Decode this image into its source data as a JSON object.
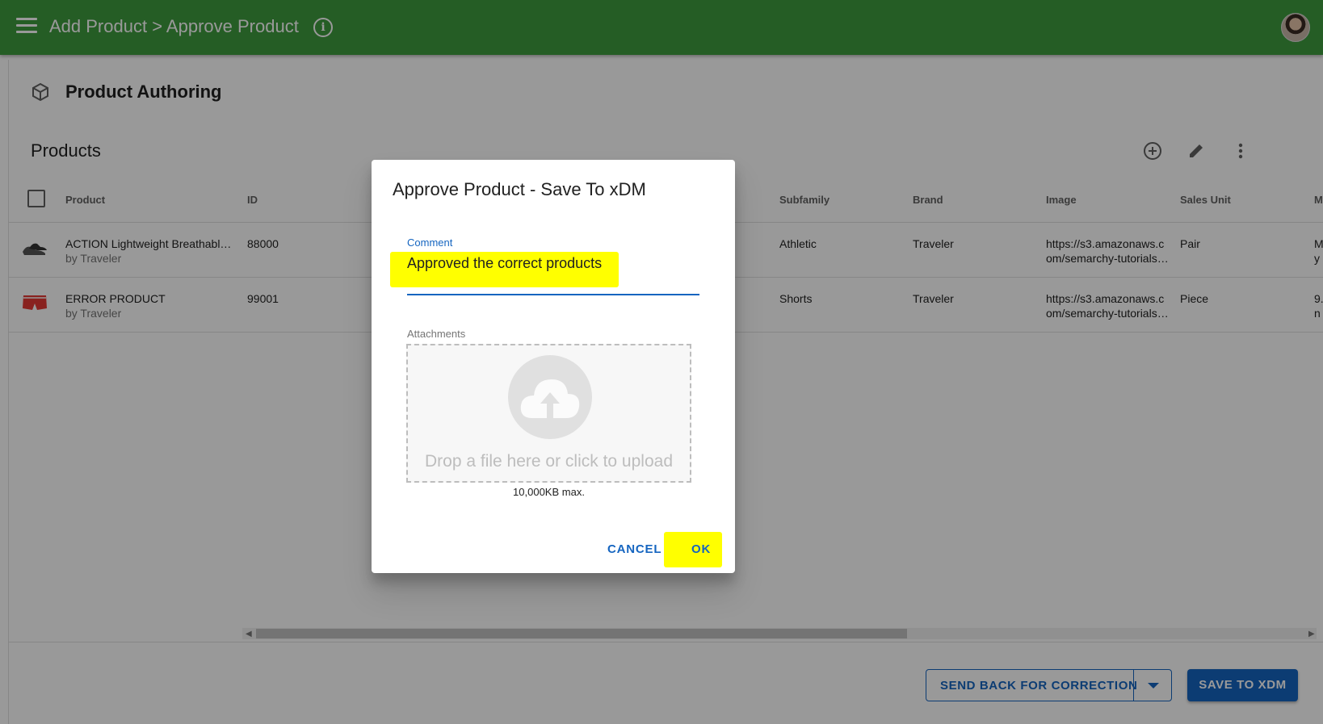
{
  "appbar": {
    "title": "Add Product > Approve Product",
    "info_icon_glyph": "i"
  },
  "page": {
    "section_title": "Product Authoring",
    "list_title": "Products"
  },
  "table": {
    "columns": [
      "Product",
      "ID",
      "Subfamily",
      "Brand",
      "Image",
      "Sales Unit",
      "M"
    ],
    "rows": [
      {
        "product": "ACTION Lightweight Breathabl…",
        "by": "by Traveler",
        "id": "88000",
        "subfamily": "Athletic",
        "brand": "Traveler",
        "image_line1": "https://s3.amazonaws.c",
        "image_line2": "om/semarchy-tutorials…",
        "sales_unit": "Pair",
        "extra_line1": "M",
        "extra_line2": "y"
      },
      {
        "product": "ERROR PRODUCT",
        "by": "by Traveler",
        "id": "99001",
        "subfamily": "Shorts",
        "brand": "Traveler",
        "image_line1": "https://s3.amazonaws.c",
        "image_line2": "om/semarchy-tutorials…",
        "sales_unit": "Piece",
        "extra_line1": "9.",
        "extra_line2": "n"
      }
    ]
  },
  "actions": {
    "send_back": "SEND BACK FOR CORRECTION",
    "save": "SAVE TO XDM"
  },
  "dialog": {
    "title": "Approve Product - Save To xDM",
    "comment_label": "Comment",
    "comment_value": "Approved the correct products",
    "attachments_label": "Attachments",
    "drop_text": "Drop a file here or click to upload",
    "max_size": "10,000KB max.",
    "cancel": "CANCEL",
    "ok": "OK"
  },
  "colors": {
    "appbar": "#3f9b3f",
    "primary": "#1565c0",
    "highlight": "#ffff00"
  }
}
